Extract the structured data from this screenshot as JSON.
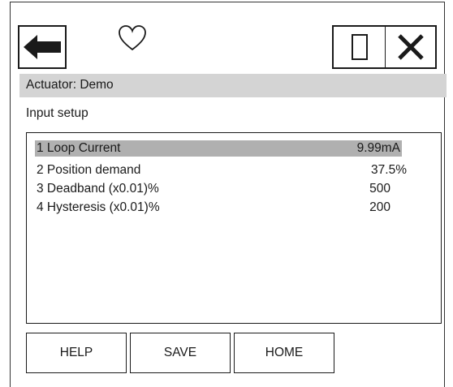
{
  "header": {
    "back_icon": "left-arrow-icon",
    "favorite_icon": "heart-outline-icon",
    "blank_icon": "empty-rectangle-icon",
    "close_icon": "close-x-icon"
  },
  "title_bar": {
    "text": "Actuator: Demo"
  },
  "subtitle": "Input setup",
  "list": {
    "items": [
      {
        "label": "1 Loop Current",
        "value": "9.99mA",
        "selected": true
      },
      {
        "label": "2 Position demand",
        "value": "37.5%",
        "selected": false
      },
      {
        "label": "3 Deadband (x0.01)%",
        "value": "500",
        "selected": false
      },
      {
        "label": "4 Hysteresis (x0.01)%",
        "value": "200",
        "selected": false
      }
    ]
  },
  "buttons": {
    "help": "HELP",
    "save": "SAVE",
    "home": "HOME"
  },
  "colors": {
    "title_bar_bg": "#d4d4d4",
    "selected_row_bg": "#b0b0b0"
  }
}
